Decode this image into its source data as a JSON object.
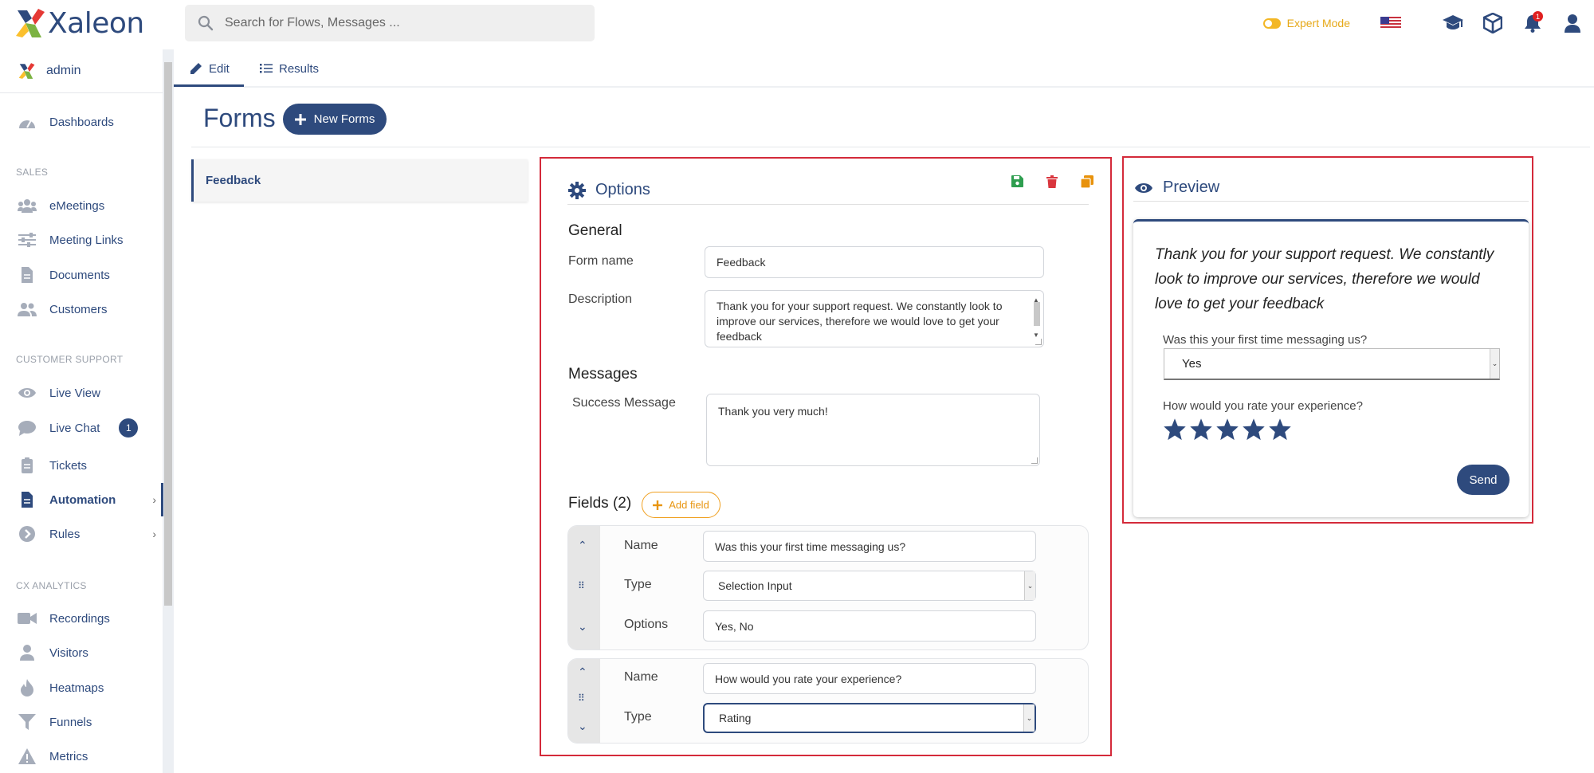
{
  "brand": {
    "name": "Xaleon"
  },
  "search": {
    "placeholder": "Search for Flows, Messages ..."
  },
  "topbar": {
    "expert_mode_label": "Expert Mode",
    "notification_count": "1"
  },
  "sidebar": {
    "user": "admin",
    "dashboards": "Dashboards",
    "sections": {
      "sales": "SALES",
      "customer_support": "CUSTOMER SUPPORT",
      "cx_analytics": "CX ANALYTICS"
    },
    "items": {
      "emeetings": "eMeetings",
      "meeting_links": "Meeting Links",
      "documents": "Documents",
      "customers": "Customers",
      "live_view": "Live View",
      "live_chat": "Live Chat",
      "live_chat_badge": "1",
      "tickets": "Tickets",
      "automation": "Automation",
      "rules": "Rules",
      "recordings": "Recordings",
      "visitors": "Visitors",
      "heatmaps": "Heatmaps",
      "funnels": "Funnels",
      "metrics": "Metrics"
    }
  },
  "tabs": {
    "edit": "Edit",
    "results": "Results"
  },
  "page": {
    "title": "Forms",
    "new_button": "New Forms"
  },
  "form_list": {
    "items": [
      "Feedback"
    ]
  },
  "options": {
    "title": "Options",
    "general_title": "General",
    "form_name_label": "Form name",
    "form_name_value": "Feedback",
    "description_label": "Description",
    "description_value": "Thank you for your support request. We constantly look to improve our services, therefore we would love to get your feedback",
    "messages_title": "Messages",
    "success_label": "Success Message",
    "success_value": "Thank you very much!",
    "fields_title": "Fields (2)",
    "add_field": "Add field",
    "fields": [
      {
        "name_label": "Name",
        "name_value": "Was this your first time messaging us?",
        "type_label": "Type",
        "type_value": "Selection Input",
        "options_label": "Options",
        "options_value": "Yes, No"
      },
      {
        "name_label": "Name",
        "name_value": "How would you rate your experience?",
        "type_label": "Type",
        "type_value": "Rating"
      }
    ]
  },
  "preview": {
    "title": "Preview",
    "description": "Thank you for your support request. We constantly look to improve our services, therefore we would love to get your feedback",
    "q1": "Was this your first time messaging us?",
    "q1_selected": "Yes",
    "q2": "How would you rate your experience?",
    "rating_max": 5,
    "send": "Send"
  },
  "colors": {
    "primary": "#2e4a7d",
    "accent": "#e6a817",
    "highlight_border": "#d42a3a",
    "save": "#2e9e4f",
    "delete": "#d9363e",
    "copy": "#e8920c"
  }
}
